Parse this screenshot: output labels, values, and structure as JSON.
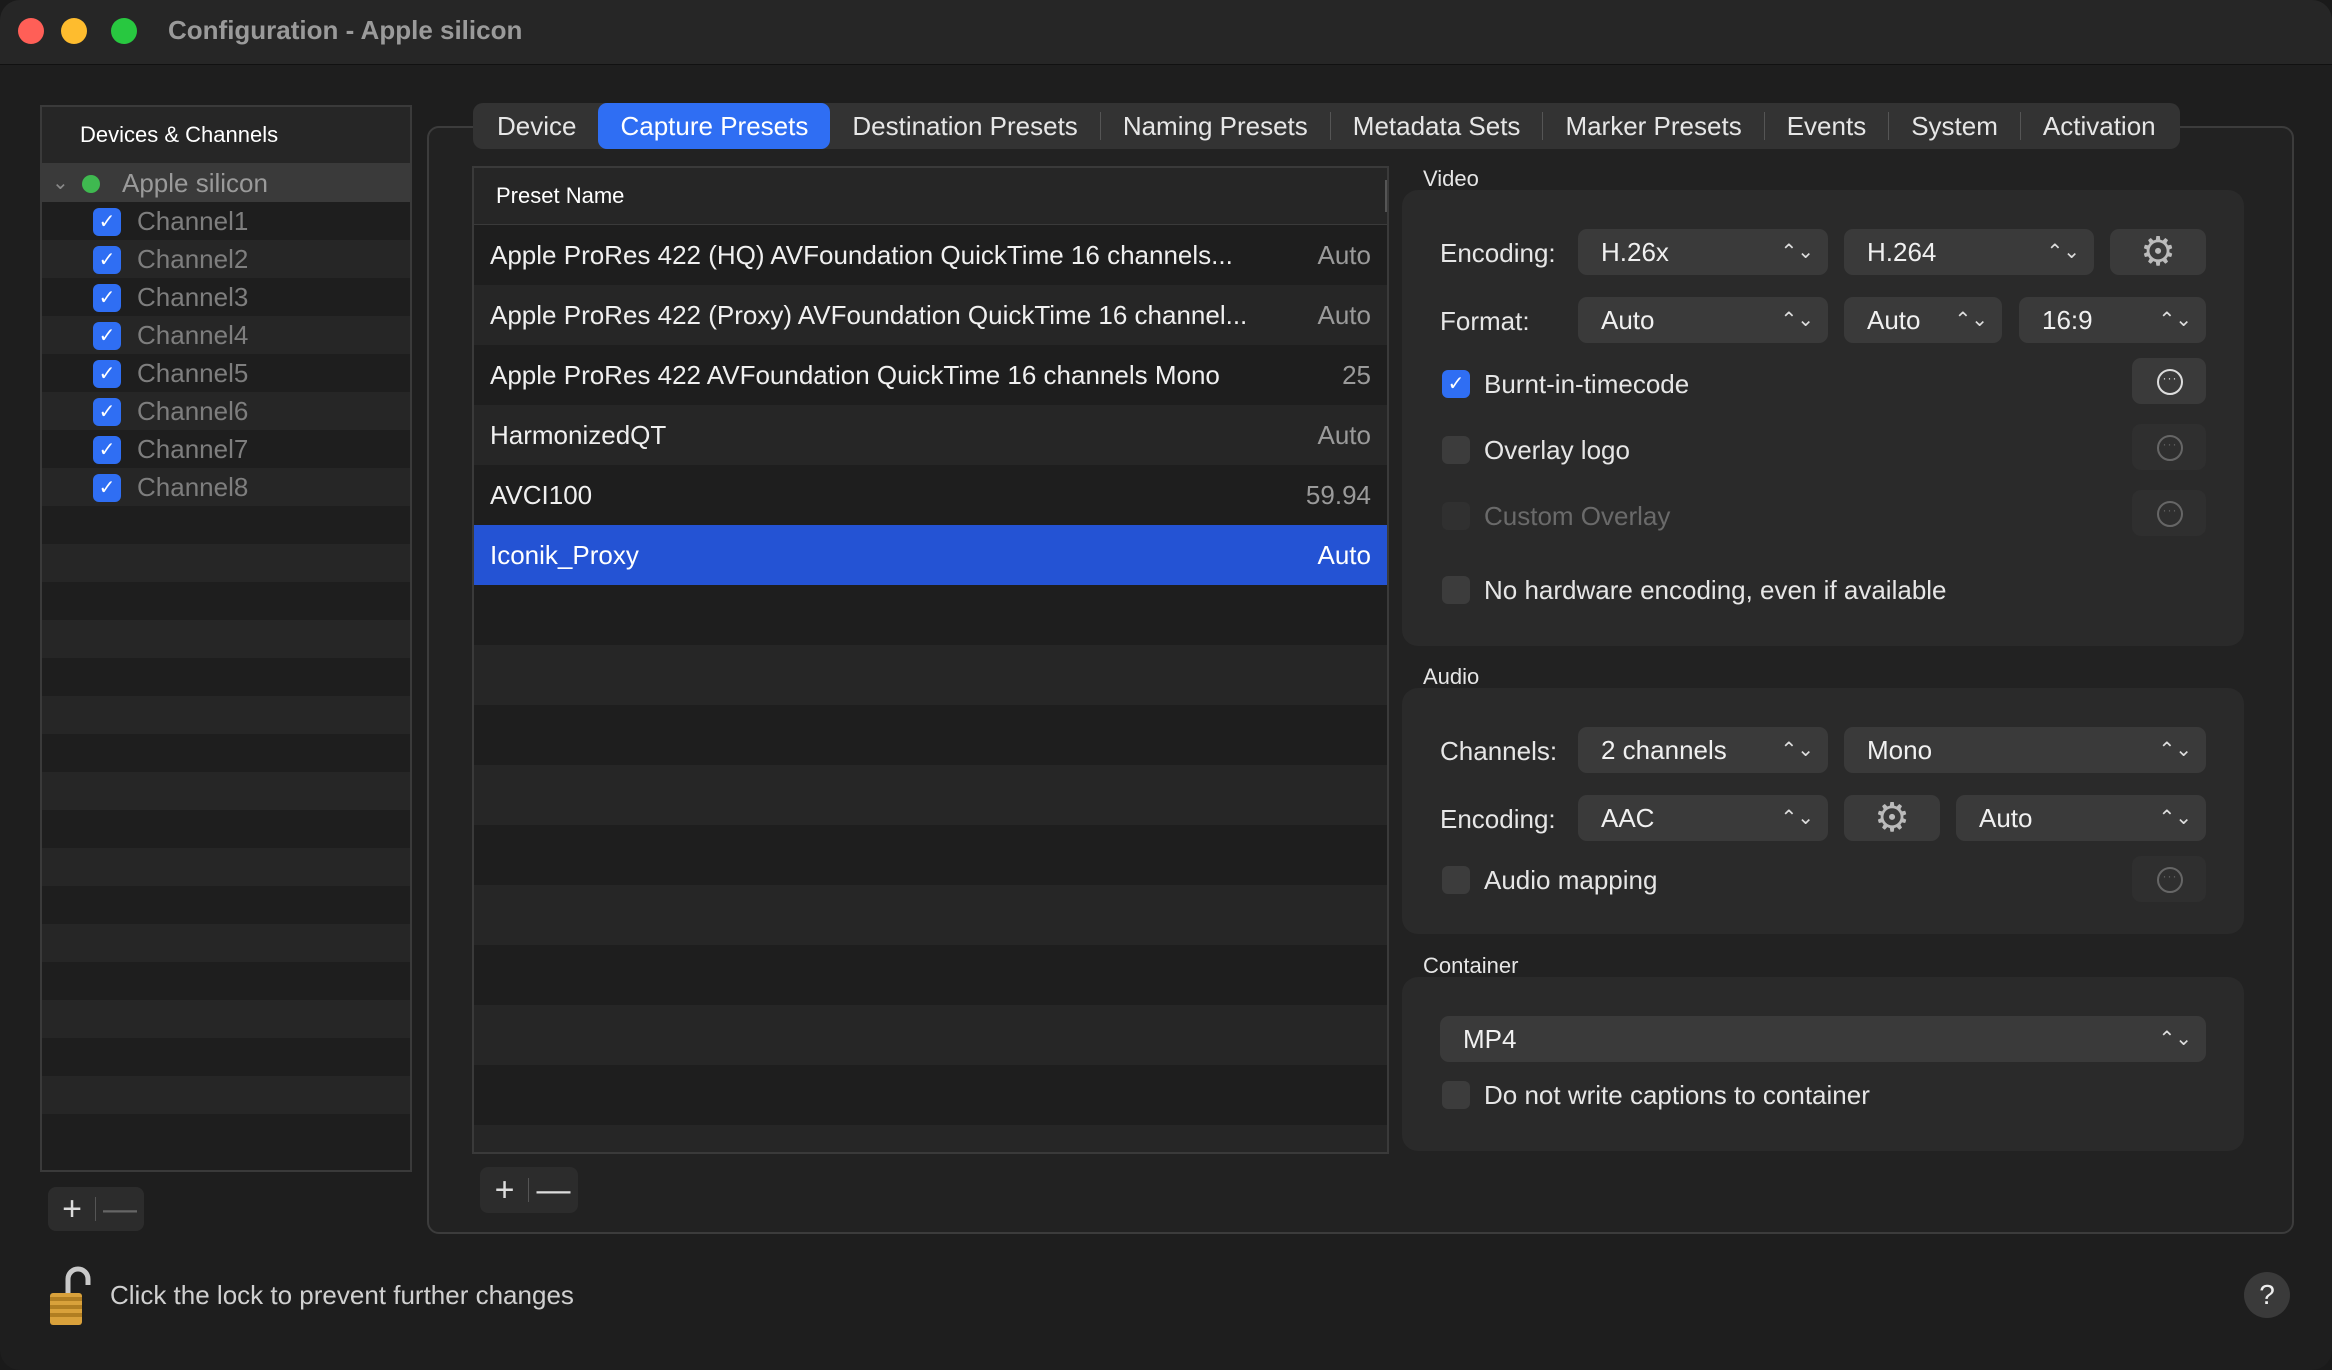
{
  "window": {
    "title": "Configuration - Apple silicon"
  },
  "sidebar": {
    "header": "Devices & Channels",
    "device": {
      "name": "Apple silicon",
      "status_color": "#3fb950"
    },
    "channels": [
      {
        "label": "Channel1",
        "checked": true
      },
      {
        "label": "Channel2",
        "checked": true
      },
      {
        "label": "Channel3",
        "checked": true
      },
      {
        "label": "Channel4",
        "checked": true
      },
      {
        "label": "Channel5",
        "checked": true
      },
      {
        "label": "Channel6",
        "checked": true
      },
      {
        "label": "Channel7",
        "checked": true
      },
      {
        "label": "Channel8",
        "checked": true
      }
    ],
    "add_label": "+",
    "remove_label": "—"
  },
  "tabs": [
    {
      "label": "Device",
      "active": false
    },
    {
      "label": "Capture Presets",
      "active": true
    },
    {
      "label": "Destination Presets",
      "active": false
    },
    {
      "label": "Naming Presets",
      "active": false
    },
    {
      "label": "Metadata Sets",
      "active": false
    },
    {
      "label": "Marker Presets",
      "active": false
    },
    {
      "label": "Events",
      "active": false
    },
    {
      "label": "System",
      "active": false
    },
    {
      "label": "Activation",
      "active": false
    }
  ],
  "presets": {
    "column_header": "Preset Name",
    "rows": [
      {
        "name": "Apple ProRes 422 (HQ) AVFoundation QuickTime 16 channels...",
        "rate": "Auto"
      },
      {
        "name": "Apple ProRes 422 (Proxy) AVFoundation QuickTime 16 channel...",
        "rate": "Auto"
      },
      {
        "name": "Apple ProRes 422 AVFoundation QuickTime 16 channels Mono",
        "rate": "25"
      },
      {
        "name": "HarmonizedQT",
        "rate": "Auto"
      },
      {
        "name": "AVCI100",
        "rate": "59.94"
      },
      {
        "name": "Iconik_Proxy",
        "rate": "Auto",
        "selected": true
      }
    ],
    "add_label": "+",
    "remove_label": "—"
  },
  "video": {
    "section_title": "Video",
    "encoding_label": "Encoding:",
    "encoding_family": "H.26x",
    "encoding_codec": "H.264",
    "format_label": "Format:",
    "format_size": "Auto",
    "format_rate": "Auto",
    "format_aspect": "16:9",
    "burnt_in_label": "Burnt-in-timecode",
    "burnt_in_checked": true,
    "overlay_logo_label": "Overlay logo",
    "overlay_logo_checked": false,
    "custom_overlay_label": "Custom Overlay",
    "custom_overlay_checked": false,
    "no_hw_label": "No hardware encoding, even if available",
    "no_hw_checked": false
  },
  "audio": {
    "section_title": "Audio",
    "channels_label": "Channels:",
    "channels_value": "2 channels",
    "channels_mode": "Mono",
    "encoding_label": "Encoding:",
    "encoding_value": "AAC",
    "encoding_rate": "Auto",
    "mapping_label": "Audio mapping",
    "mapping_checked": false
  },
  "container": {
    "section_title": "Container",
    "format_value": "MP4",
    "no_captions_label": "Do not write captions to container",
    "no_captions_checked": false
  },
  "footer": {
    "lock_text": "Click the lock to prevent further changes",
    "help_label": "?"
  },
  "colors": {
    "accent": "#2f6ef3",
    "selection": "#2453d4"
  }
}
